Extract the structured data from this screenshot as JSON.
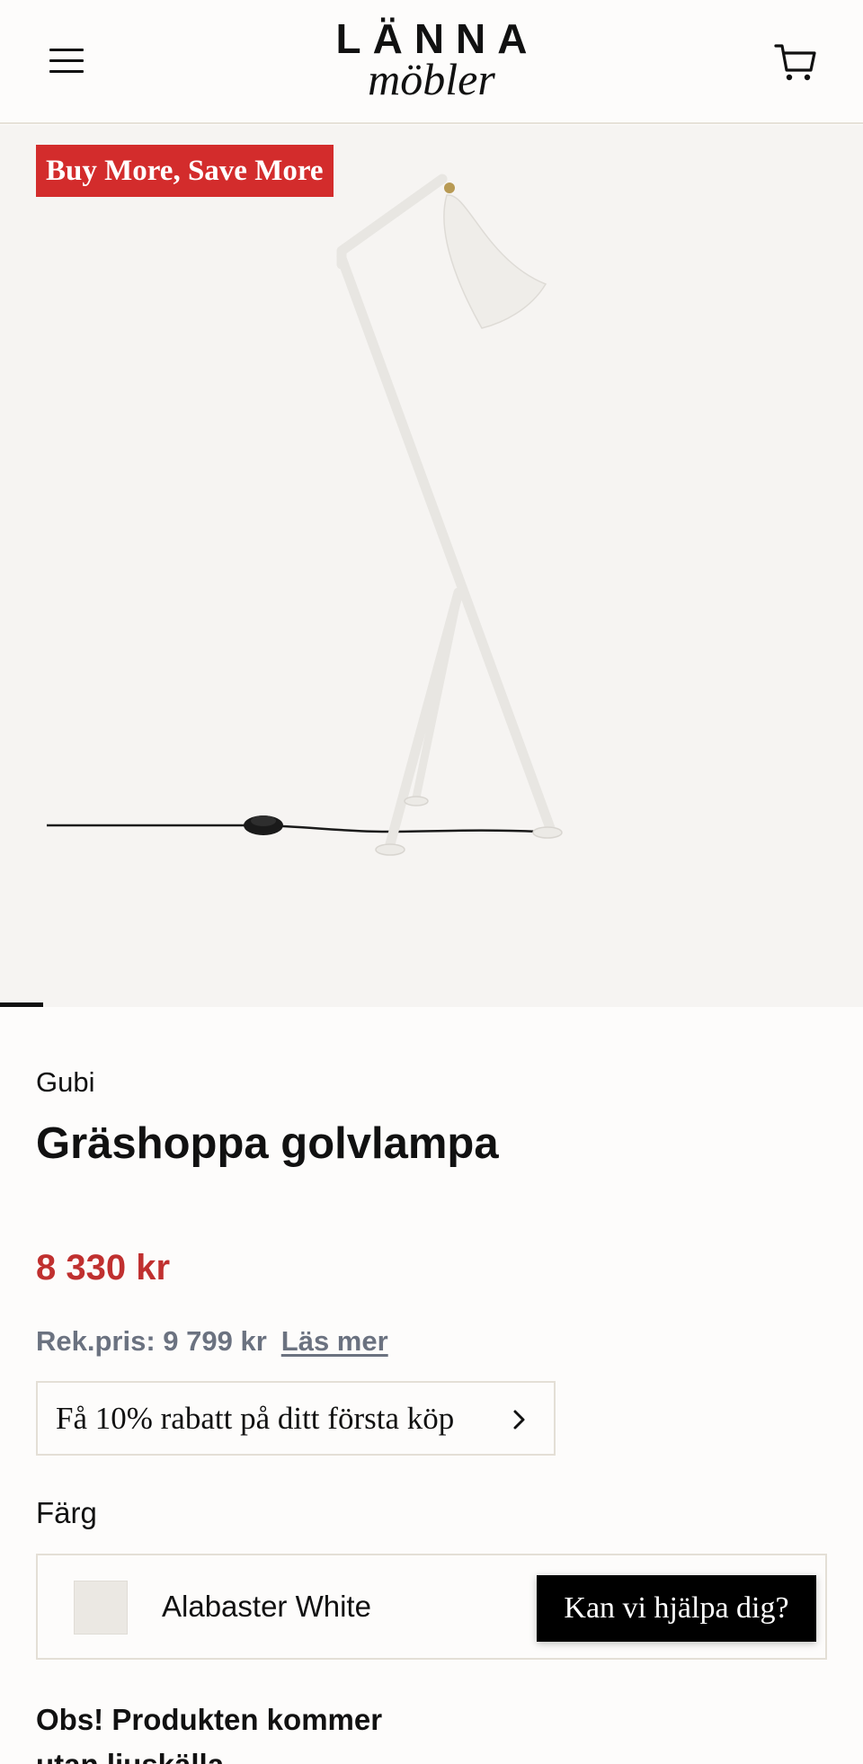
{
  "header": {
    "menu_icon": "hamburger-menu-icon",
    "logo_top": "LÄNNA",
    "logo_bottom": "möbler",
    "cart_icon": "shopping-cart-icon"
  },
  "gallery": {
    "badge": "Buy More, Save More",
    "badge_color": "#d32c2c",
    "image_alt": "Gräshoppa golvlampa"
  },
  "product": {
    "brand": "Gubi",
    "title": "Gräshoppa golvlampa",
    "price": "8 330 kr",
    "price_color": "#c0302f",
    "rek_price": "Rek.pris: 9 799 kr",
    "read_more": "Läs mer",
    "discount_offer": "Få 10% rabatt på ditt första köp",
    "color_label": "Färg",
    "color_value": "Alabaster White",
    "note": "Obs! Produkten kommer utan ljuskälla"
  },
  "chat": {
    "help_label": "Kan vi hjälpa dig?"
  }
}
